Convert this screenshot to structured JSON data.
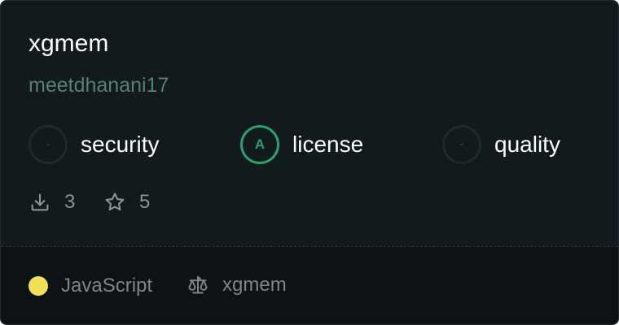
{
  "repo": {
    "name": "xgmem",
    "owner": "meetdhanani17"
  },
  "scores": [
    {
      "grade": "-",
      "label": "security"
    },
    {
      "grade": "A",
      "label": "license"
    },
    {
      "grade": "-",
      "label": "quality"
    }
  ],
  "stats": {
    "downloads": "3",
    "stars": "5"
  },
  "footer": {
    "language": "JavaScript",
    "language_color": "#f1e05a",
    "license_name": "xgmem"
  },
  "colors": {
    "grade_a": "#2f9e6c",
    "owner": "#5b7d72"
  },
  "icons": [
    "download-icon",
    "star-icon",
    "scale-icon"
  ]
}
